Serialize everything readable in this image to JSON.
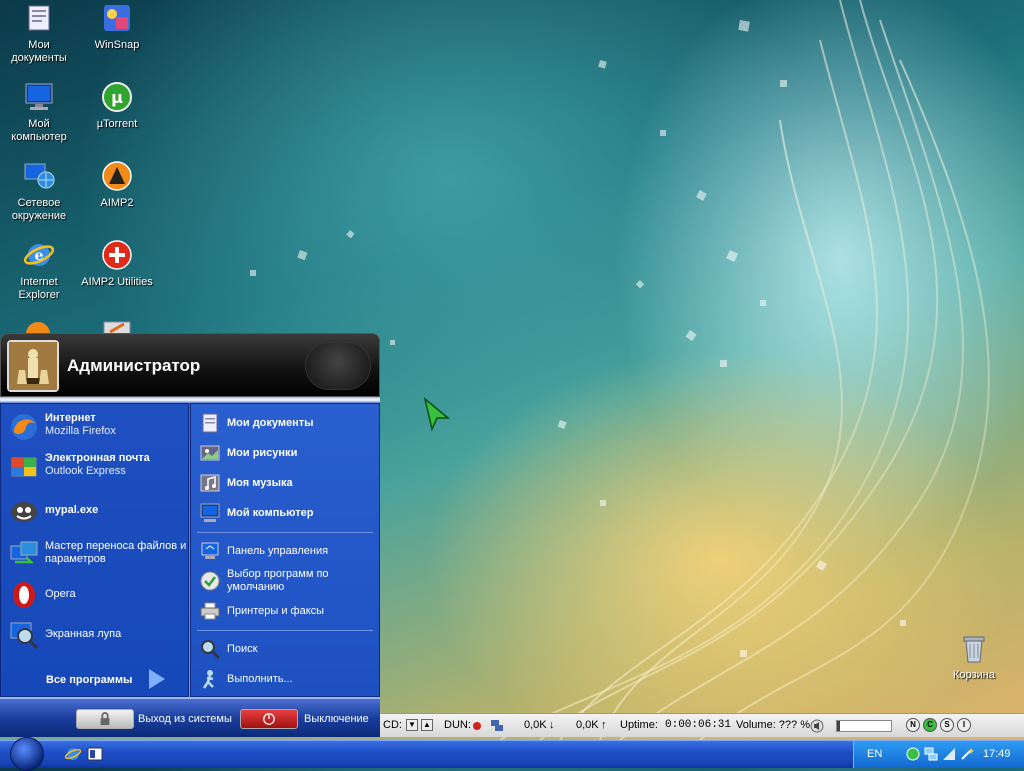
{
  "desktop": {
    "icons": [
      {
        "label": "Мои\nдокументы",
        "icon": "my-documents-icon"
      },
      {
        "label": "WinSnap",
        "icon": "winsnap-icon"
      },
      {
        "label": "Мой\nкомпьютер",
        "icon": "my-computer-icon"
      },
      {
        "label": "µTorrent",
        "icon": "utorrent-icon"
      },
      {
        "label": "Сетевое\nокружение",
        "icon": "network-icon"
      },
      {
        "label": "AIMP2",
        "icon": "aimp2-icon"
      },
      {
        "label": "Internet\nExplorer",
        "icon": "internet-explorer-icon"
      },
      {
        "label": "AIMP2 Utilities",
        "icon": "aimp2-utilities-icon"
      },
      {
        "label": "Корзина",
        "icon": "recycle-bin-icon"
      }
    ]
  },
  "start_menu": {
    "user_name": "Администратор",
    "left_items": [
      {
        "title": "Интернет",
        "subtitle": "Mozilla Firefox",
        "icon": "firefox-icon"
      },
      {
        "title": "Электронная почта",
        "subtitle": "Outlook Express",
        "icon": "outlook-express-icon"
      },
      {
        "title": "mypal.exe",
        "subtitle": "",
        "icon": "mypal-icon"
      },
      {
        "title": "Мастер переноса файлов и параметров",
        "subtitle": "",
        "icon": "transfer-wizard-icon"
      },
      {
        "title": "Opera",
        "subtitle": "",
        "icon": "opera-icon"
      },
      {
        "title": "Экранная лупа",
        "subtitle": "",
        "icon": "magnifier-icon"
      }
    ],
    "all_programs": "Все программы",
    "right_items": [
      {
        "label": "Мои документы",
        "icon": "my-documents-icon"
      },
      {
        "label": "Мои рисунки",
        "icon": "my-pictures-icon"
      },
      {
        "label": "Моя музыка",
        "icon": "my-music-icon"
      },
      {
        "label": "Мой компьютер",
        "icon": "my-computer-icon"
      },
      {
        "label": "Панель управления",
        "icon": "control-panel-icon"
      },
      {
        "label": "Выбор программ по умолчанию",
        "icon": "default-programs-icon"
      },
      {
        "label": "Принтеры и факсы",
        "icon": "printers-icon"
      },
      {
        "label": "Поиск",
        "icon": "search-icon"
      },
      {
        "label": "Выполнить...",
        "icon": "run-icon"
      }
    ],
    "logoff": "Выход из системы",
    "shutdown": "Выключение"
  },
  "monitor_bar": {
    "cd_label": "CD:",
    "dun_label": "DUN:",
    "down_rate": "0,0K",
    "up_rate": "0,0K",
    "uptime_label": "Uptime:",
    "uptime_value": "0:00:06:31",
    "volume_label": "Volume: ??? %",
    "circles": [
      "N",
      "C",
      "S",
      "I"
    ]
  },
  "taskbar": {
    "language": "EN",
    "clock": "17:49"
  },
  "colors": {
    "taskbar_blue": "#1e4fc8",
    "menu_blue": "#1f4fc0",
    "shutdown_red": "#c01818"
  }
}
